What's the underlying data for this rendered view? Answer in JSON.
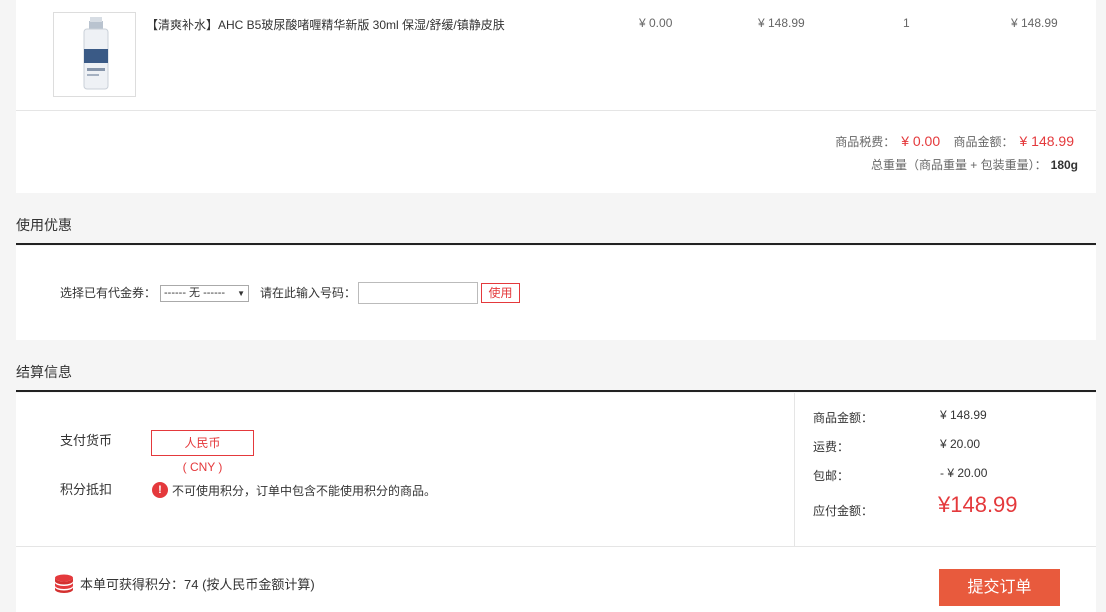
{
  "product": {
    "name": "【清爽补水】AHC B5玻尿酸啫喱精华新版 30ml 保湿/舒缓/镇静皮肤",
    "tax": "¥ 0.00",
    "price": "¥ 148.99",
    "quantity": "1",
    "subtotal": "¥ 148.99",
    "image_icon": "serum-bottle-icon"
  },
  "summary": {
    "tax_label": "商品税费：",
    "tax_value": "¥ 0.00",
    "amount_label": "商品金额：",
    "amount_value": "¥ 148.99",
    "weight_label": "总重量（商品重量 + 包装重量）：",
    "weight_value": "180g"
  },
  "coupon": {
    "section_title": "使用优惠",
    "select_label": "选择已有代金券：",
    "select_value": "------ 无 ------",
    "code_label": "请在此输入号码：",
    "code_value": "",
    "use_button": "使用"
  },
  "settlement": {
    "section_title": "结算信息",
    "pay_currency_label": "支付货币",
    "currency": "人民币",
    "currency_code": "( CNY )",
    "points_label": "积分抵扣",
    "points_warning": "不可使用积分，订单中包含不能使用积分的商品。",
    "rows": [
      {
        "label": "商品金额：",
        "value": "¥ 148.99"
      },
      {
        "label": "运费：",
        "value": "¥ 20.00"
      },
      {
        "label": "包邮：",
        "value": "- ¥ 20.00"
      }
    ],
    "total_label": "应付金额：",
    "total_value": "¥148.99"
  },
  "footer": {
    "points_earned": "本单可获得积分：74  (按人民币金额计算)",
    "submit_button": "提交订单"
  },
  "colors": {
    "accent": "#e4393c",
    "submit": "#e85a3d"
  }
}
